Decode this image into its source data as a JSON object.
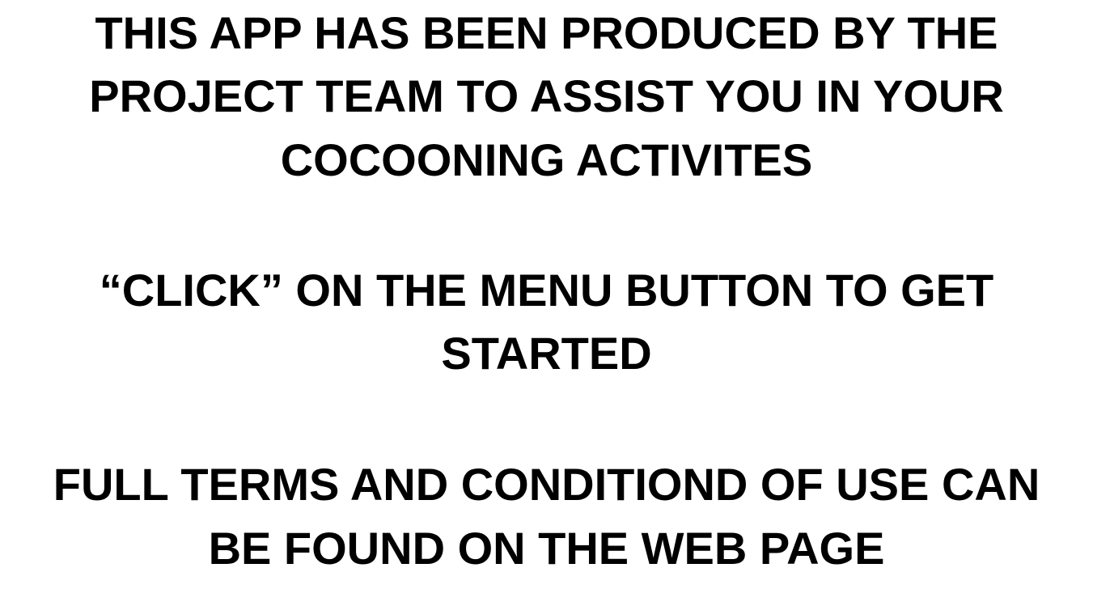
{
  "intro": {
    "line1": "THIS APP HAS BEEN PRODUCED BY THE",
    "line2": "PROJECT TEAM TO ASSIST YOU IN YOUR",
    "line3": "COCOONING ACTIVITES"
  },
  "instruction": {
    "line1": "“CLICK” ON THE MENU BUTTON TO GET",
    "line2": "STARTED"
  },
  "terms": {
    "line1": "FULL TERMS AND CONDITIOND OF USE CAN",
    "line2": "BE FOUND ON THE WEB PAGE"
  },
  "colors": {
    "background": "#ffffff",
    "text": "#000000"
  }
}
